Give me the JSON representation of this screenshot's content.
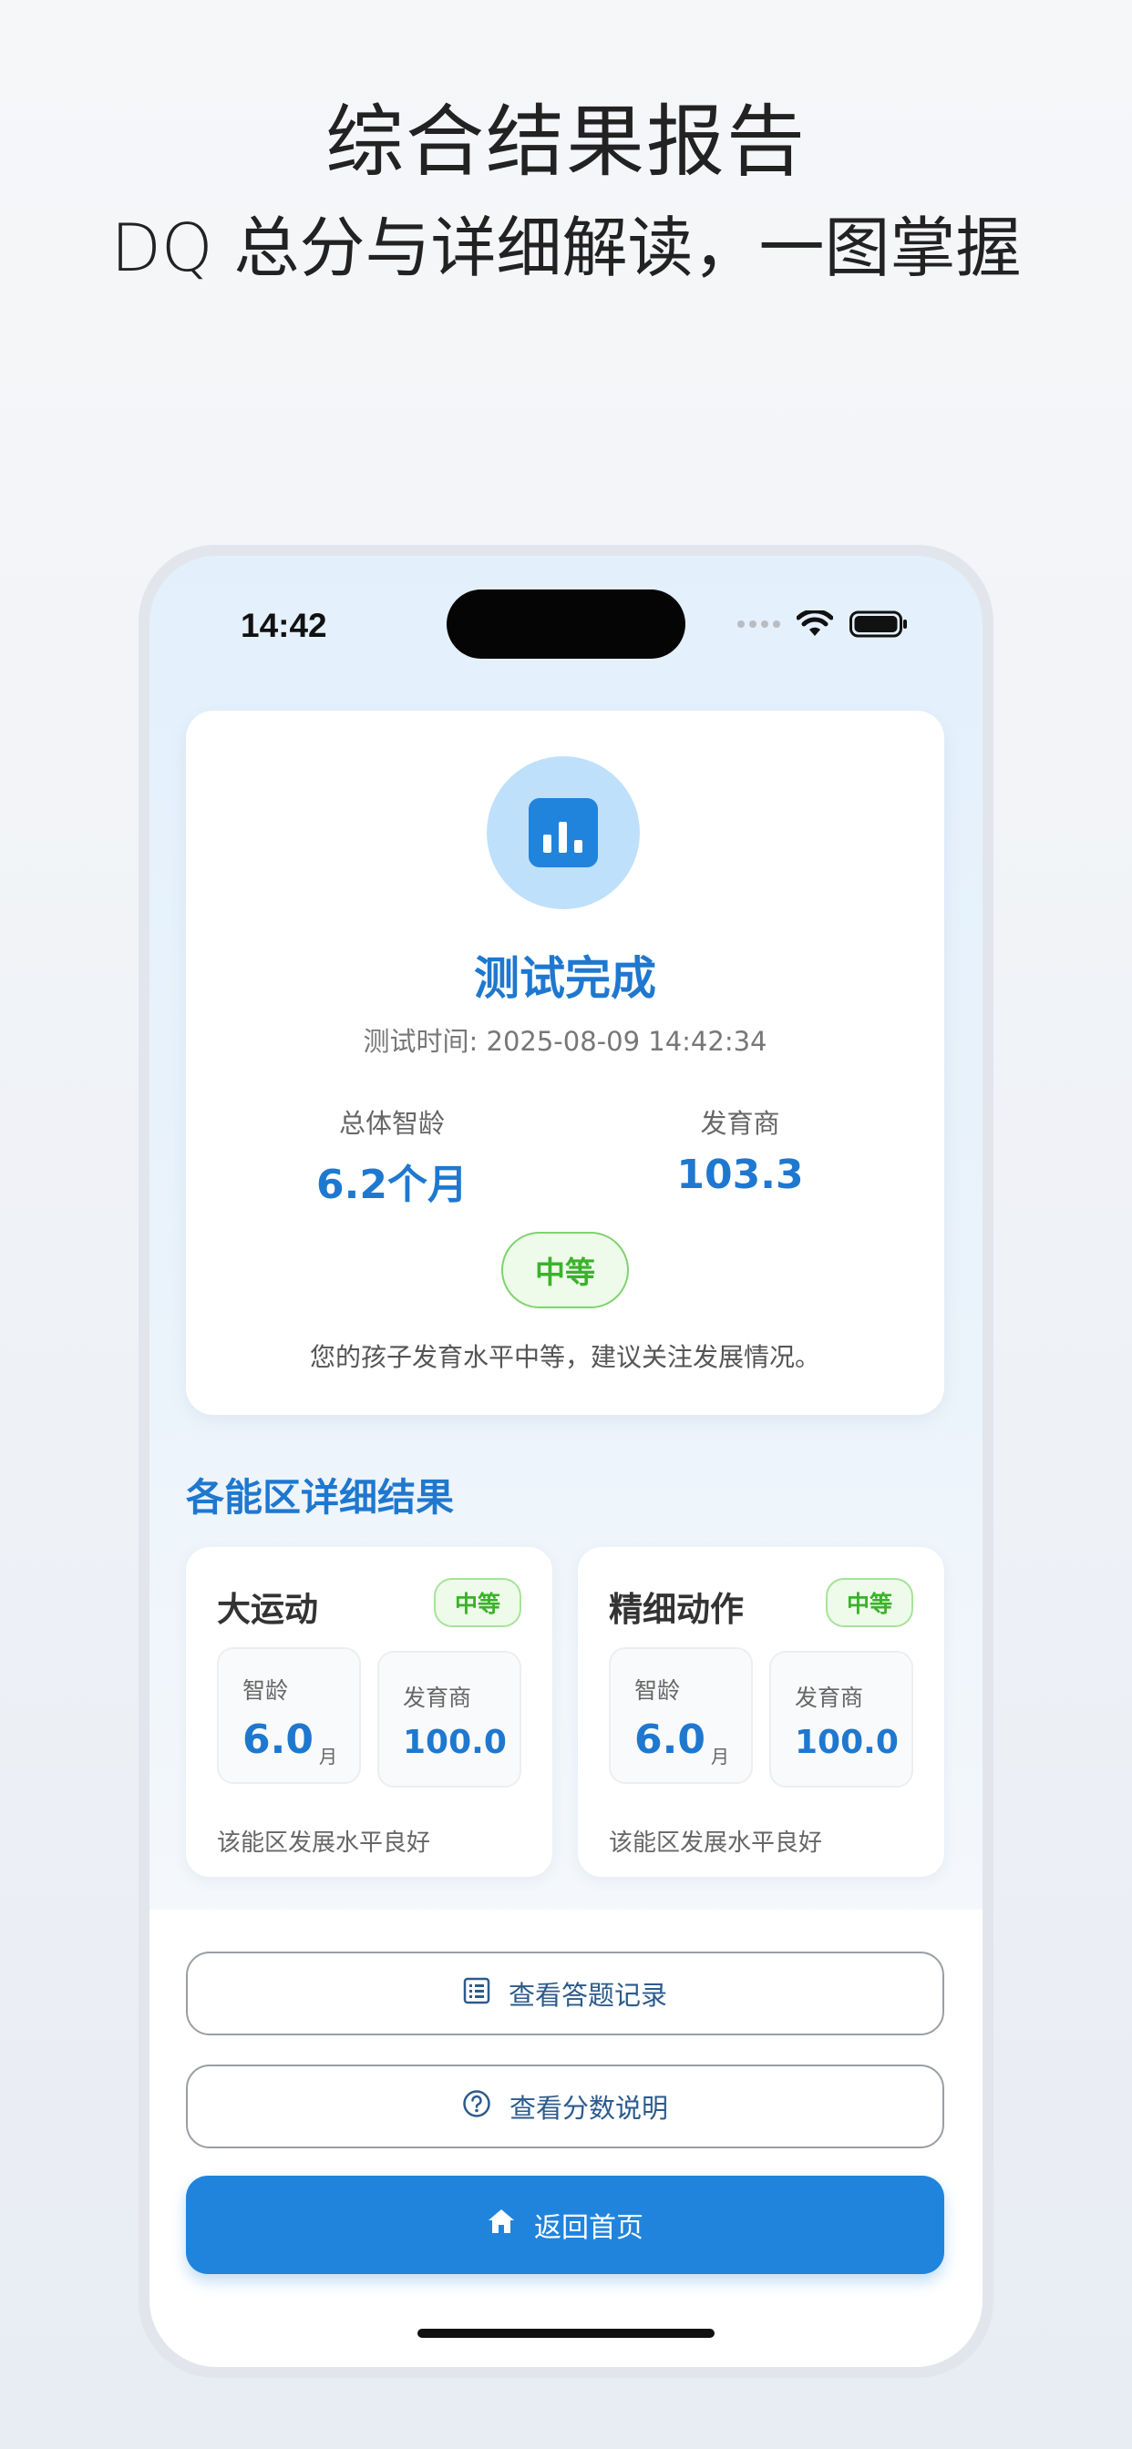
{
  "headline": {
    "line1": "综合结果报告",
    "line2": "DQ 总分与详细解读，一图掌握"
  },
  "status_bar": {
    "time": "14:42",
    "icons": [
      "signal-dots-icon",
      "wifi-icon",
      "battery-icon"
    ]
  },
  "summary": {
    "icon": "bar-chart-icon",
    "title": "测试完成",
    "test_time": "测试时间: 2025-08-09 14:42:34",
    "metrics": [
      {
        "label": "总体智龄",
        "value": "6.2个月"
      },
      {
        "label": "发育商",
        "value": "103.3"
      }
    ],
    "level_badge": "中等",
    "description": "您的孩子发育水平中等，建议关注发展情况。"
  },
  "areas_section": {
    "title": "各能区详细结果",
    "areas": [
      {
        "name": "大运动",
        "badge": "中等",
        "age_label": "智龄",
        "age_value": "6.0",
        "age_unit": "月",
        "dq_label": "发育商",
        "dq_value": "100.0",
        "note": "该能区发展水平良好"
      },
      {
        "name": "精细动作",
        "badge": "中等",
        "age_label": "智龄",
        "age_value": "6.0",
        "age_unit": "月",
        "dq_label": "发育商",
        "dq_value": "100.0",
        "note": "该能区发展水平良好"
      }
    ]
  },
  "actions": {
    "answers": {
      "label": "查看答题记录",
      "icon": "list-icon"
    },
    "score_info": {
      "label": "查看分数说明",
      "icon": "question-circle-icon"
    },
    "home": {
      "label": "返回首页",
      "icon": "home-icon"
    }
  },
  "colors": {
    "accent": "#2084dd",
    "title_blue": "#1f78cf",
    "badge_green": "#3bb22b"
  }
}
